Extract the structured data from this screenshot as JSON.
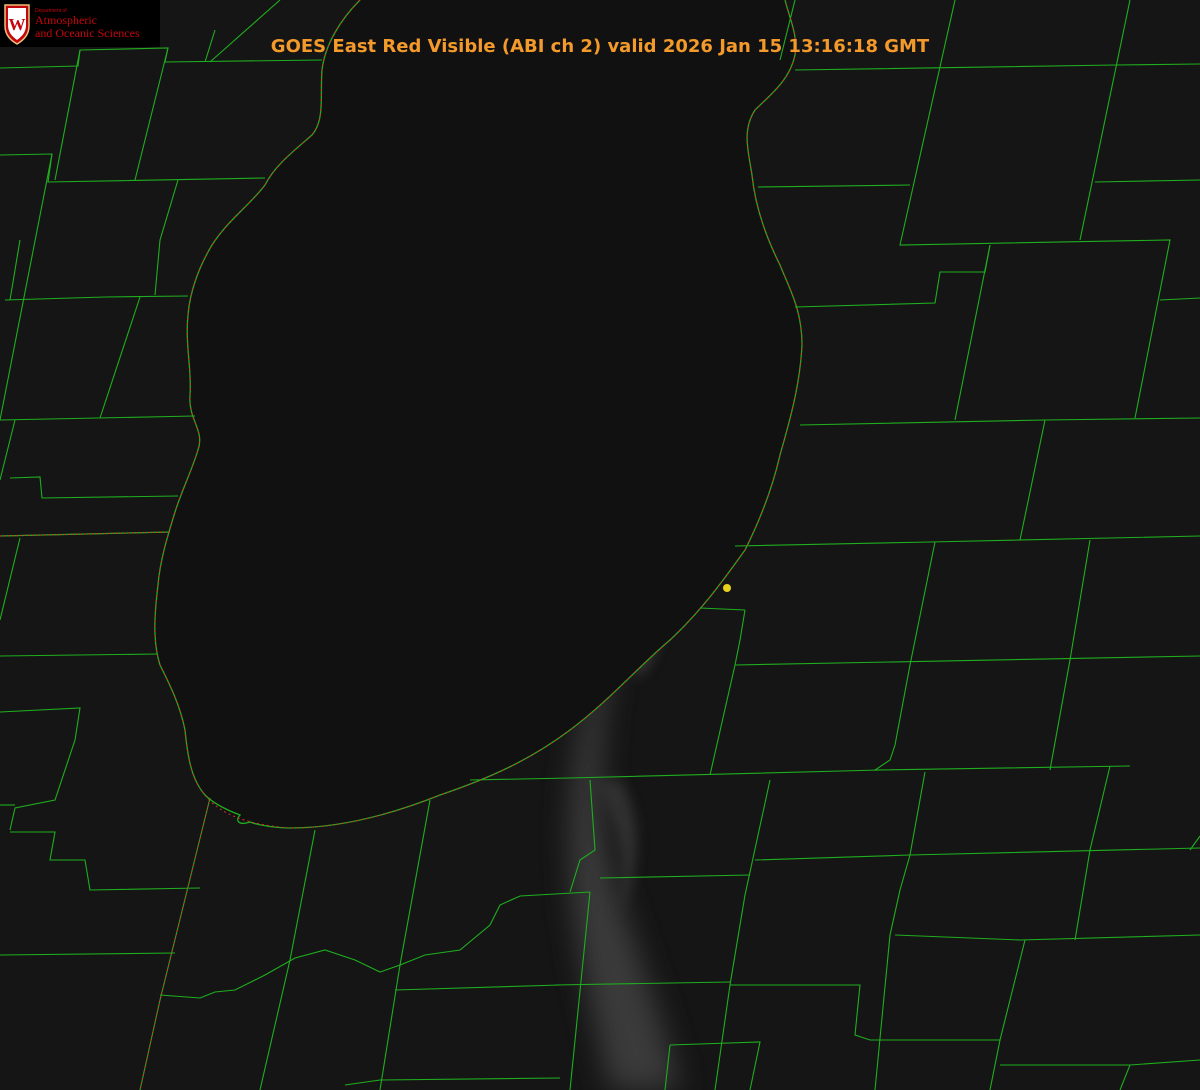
{
  "title": "GOES East Red Visible (ABI ch 2) valid 2026 Jan 15 13:16:18 GMT",
  "logo": {
    "department": "Department of",
    "line1": "Atmospheric",
    "line2": "and Oceanic Sciences",
    "crest_letter": "W"
  },
  "colors": {
    "background": "#0b0b0b",
    "county_lines": "#1fae1f",
    "coastline_dotted": "#d93030",
    "title": "#f39a2b",
    "logo_red": "#c5050c",
    "station_marker": "#e6d21c",
    "cloud_band": "#6a6a6a"
  },
  "map": {
    "product": "GOES East Red Visible",
    "channel": "ABI ch 2",
    "marker": "station-dot"
  }
}
